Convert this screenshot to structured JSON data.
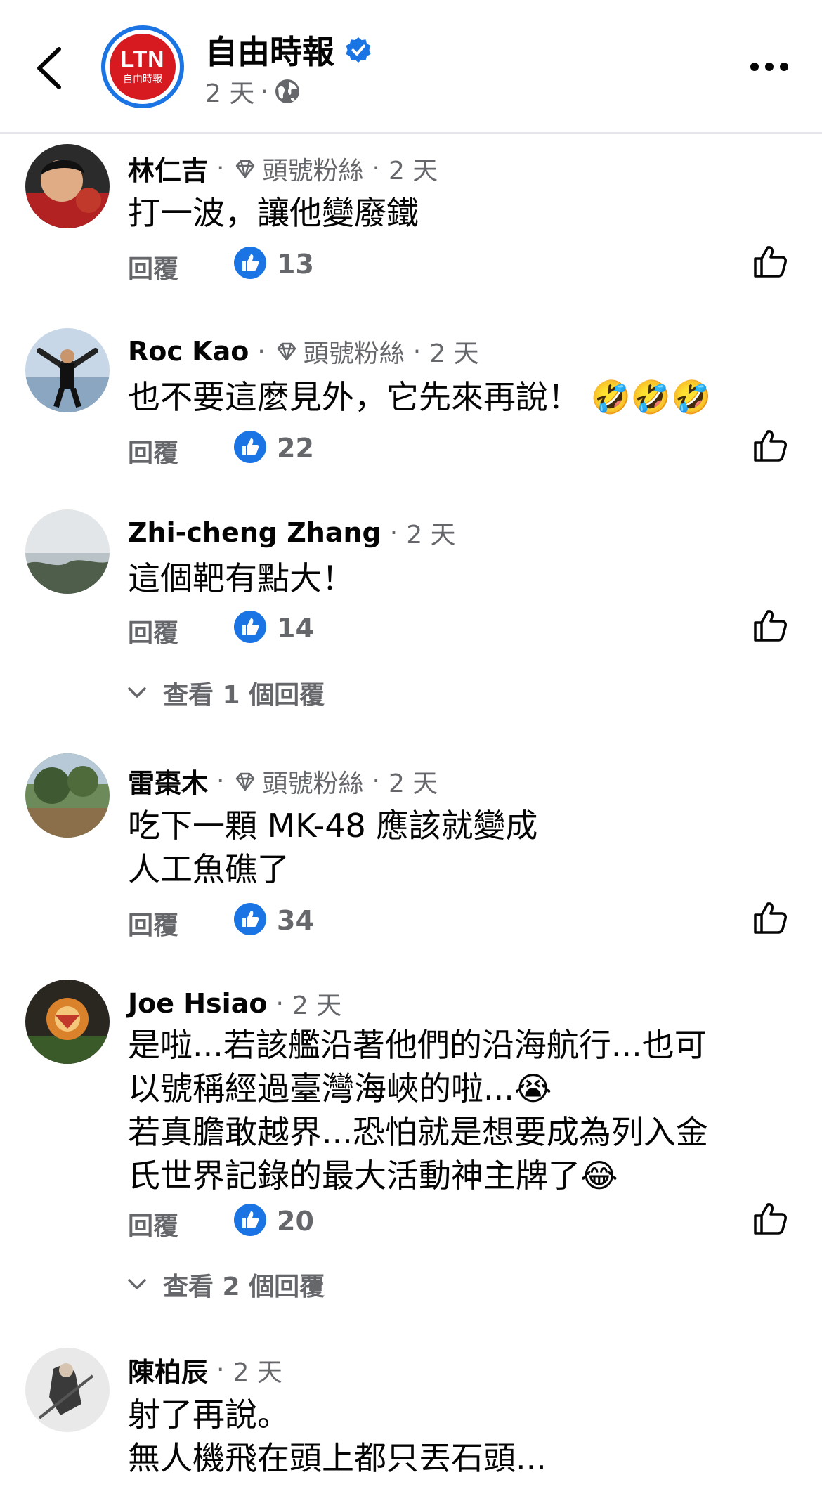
{
  "header": {
    "page_name": "自由時報",
    "logo_text": "LTN",
    "logo_sub": "自由時報",
    "time": "2 天",
    "separator": "·"
  },
  "comments": [
    {
      "author": "林仁吉",
      "badge": "頭號粉絲",
      "time": "2 天",
      "lines": [
        "打一波，讓他變廢鐵"
      ],
      "reply_label": "回覆",
      "reactions": "13"
    },
    {
      "author": "Roc Kao",
      "badge": "頭號粉絲",
      "time": "2 天",
      "lines": [
        "也不要這麼見外，它先來再說！ 🤣🤣🤣"
      ],
      "reply_label": "回覆",
      "reactions": "22"
    },
    {
      "author": "Zhi-cheng Zhang",
      "time": "2 天",
      "lines": [
        "這個靶有點大！"
      ],
      "reply_label": "回覆",
      "reactions": "14",
      "view_replies": "查看 1 個回覆"
    },
    {
      "author": "雷棗木",
      "badge": "頭號粉絲",
      "time": "2 天",
      "lines": [
        "吃下一顆 MK-48 應該就變成",
        "人工魚礁了"
      ],
      "reply_label": "回覆",
      "reactions": "34"
    },
    {
      "author": "Joe Hsiao",
      "time": "2 天",
      "lines": [
        "是啦...若該艦沿著他們的沿海航行...也可",
        "以號稱經過臺灣海峽的啦...😭",
        "若真膽敢越界...恐怕就是想要成為列入金",
        "氏世界記錄的最大活動神主牌了😂"
      ],
      "reply_label": "回覆",
      "reactions": "20",
      "view_replies": "查看 2 個回覆"
    },
    {
      "author": "陳柏辰",
      "time": "2 天",
      "lines": [
        "射了再說。",
        "無人機飛在頭上都只丟石頭..."
      ]
    }
  ],
  "colors": {
    "brand_blue": "#1b74e4",
    "secondary_text": "#65676b",
    "logo_red": "#d71920"
  }
}
